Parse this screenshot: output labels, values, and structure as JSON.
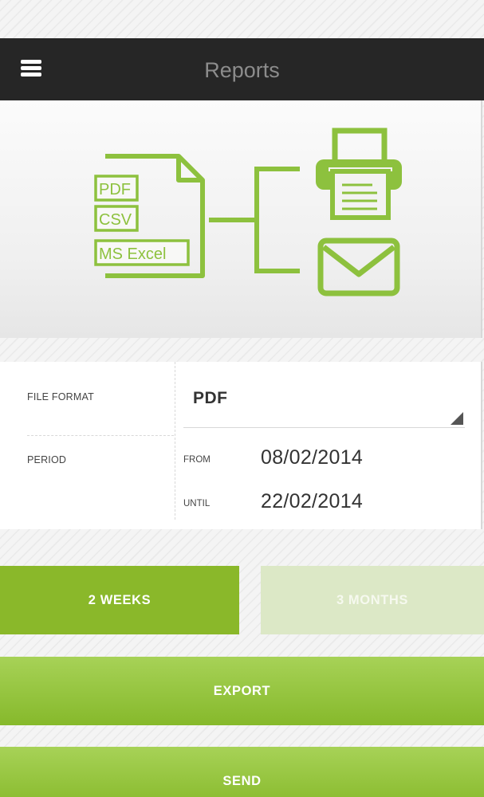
{
  "header": {
    "title": "Reports",
    "menu_icon": "hamburger-menu-icon"
  },
  "hero": {
    "accent_color": "#8dc13e",
    "document_icon": "document-icon",
    "formats": [
      "PDF",
      "CSV",
      "MS Excel"
    ],
    "printer_icon": "printer-icon",
    "mail_icon": "envelope-icon"
  },
  "form": {
    "file_format_label": "FILE FORMAT",
    "file_format_value": "PDF",
    "period_label": "PERIOD",
    "from_label": "FROM",
    "from_value": "08/02/2014",
    "until_label": "UNTIL",
    "until_value": "22/02/2014"
  },
  "ranges": {
    "two_weeks": "2 WEEKS",
    "three_months": "3 MONTHS"
  },
  "actions": {
    "export": "EXPORT",
    "send": "SEND"
  },
  "colors": {
    "header_bg": "#262626",
    "green": "#8ab82a",
    "green_light": "#dce8c6"
  }
}
